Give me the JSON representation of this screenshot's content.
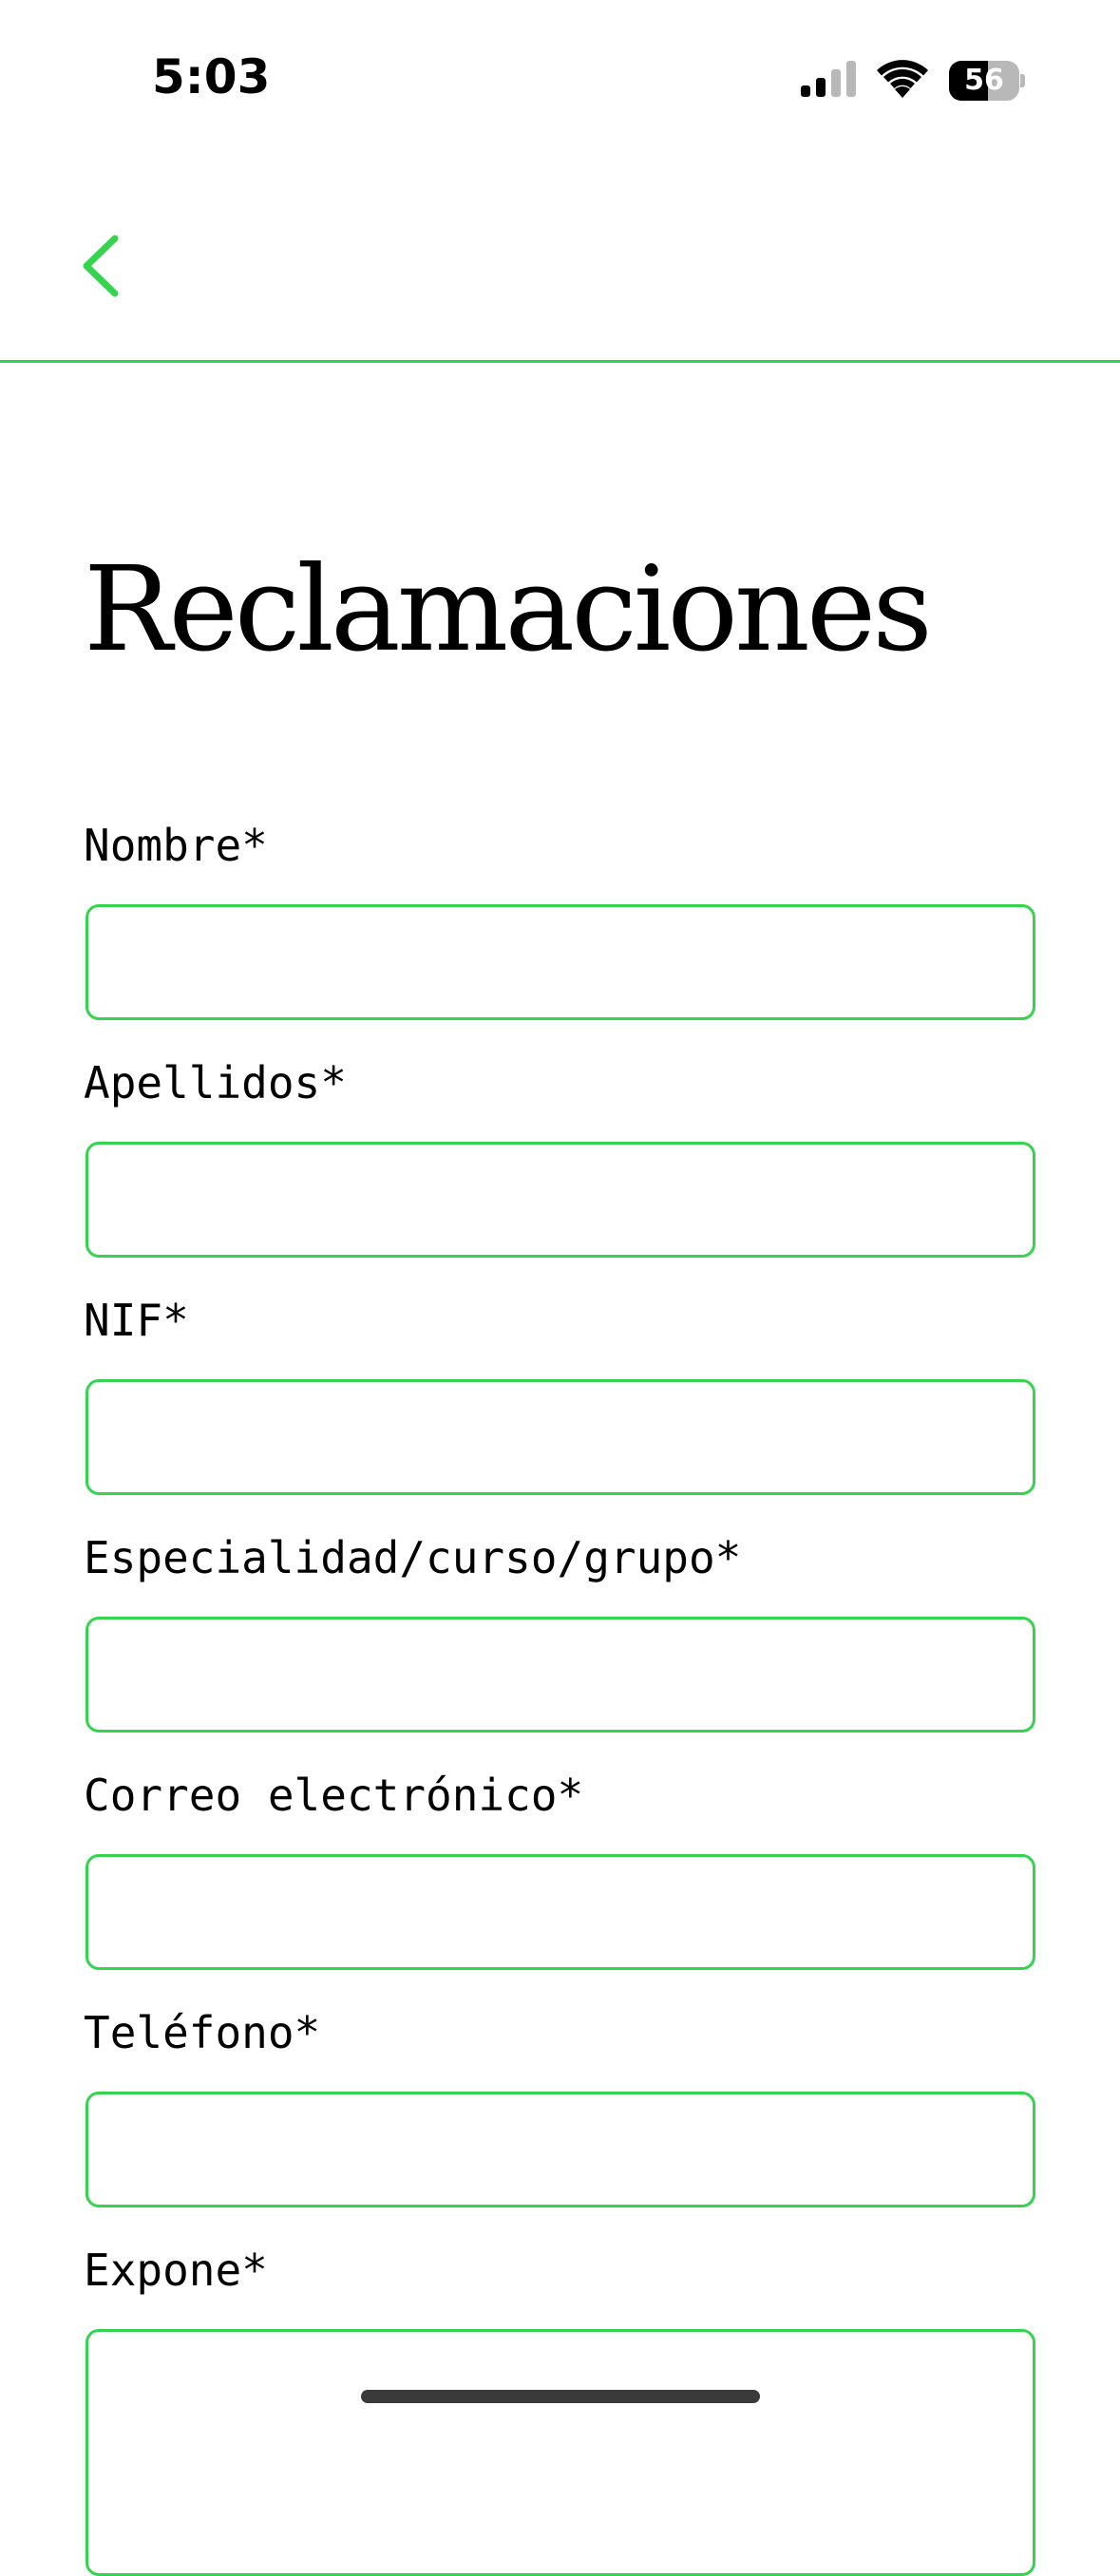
{
  "status_bar": {
    "time": "5:03",
    "battery_level": "56",
    "battery_percent": 56,
    "signal_icon": "cellular-signal-icon",
    "wifi_icon": "wifi-icon"
  },
  "nav": {
    "back_icon": "chevron-left-icon"
  },
  "page": {
    "title": "Reclamaciones"
  },
  "form": {
    "fields": [
      {
        "label": "Nombre*",
        "value": ""
      },
      {
        "label": "Apellidos*",
        "value": ""
      },
      {
        "label": "NIF*",
        "value": ""
      },
      {
        "label": "Especialidad/curso/grupo*",
        "value": ""
      },
      {
        "label": "Correo electrónico*",
        "value": ""
      },
      {
        "label": "Teléfono*",
        "value": ""
      },
      {
        "label": "Expone*",
        "value": ""
      }
    ]
  },
  "colors": {
    "accent": "#34d44e",
    "text": "#000000",
    "background": "#ffffff"
  }
}
